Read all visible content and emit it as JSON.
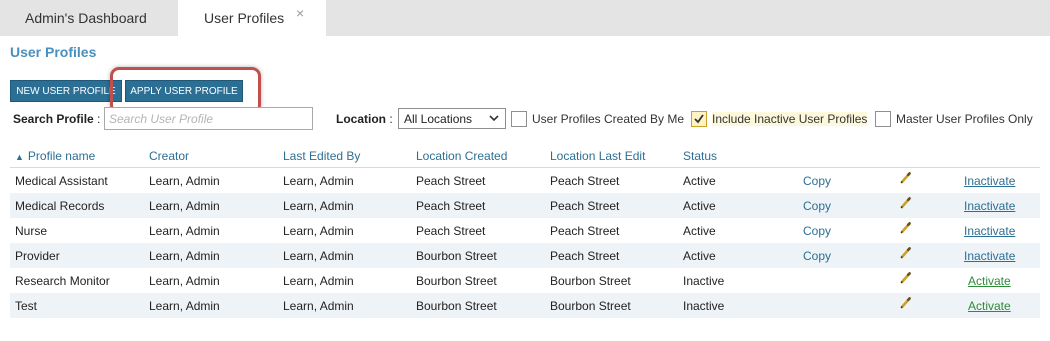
{
  "tabs": [
    {
      "label": "Admin's Dashboard"
    },
    {
      "label": "User Profiles",
      "close": "×"
    }
  ],
  "page_title": "User Profiles",
  "toolbar": {
    "new_label": "NEW USER PROFILE",
    "apply_label": "APPLY USER PROFILE"
  },
  "filters": {
    "search_label": "Search Profile",
    "search_placeholder": "Search User Profile",
    "search_value": "",
    "location_label": "Location",
    "location_value": "All Locations",
    "colon": ":",
    "cb_created_by_me": {
      "label": "User Profiles Created By Me",
      "checked": false
    },
    "cb_include_inactive": {
      "label": "Include Inactive User Profiles",
      "checked": true
    },
    "cb_master_only": {
      "label": "Master User Profiles Only",
      "checked": false
    }
  },
  "table": {
    "sort_arrow": "▲",
    "headers": [
      "Profile name",
      "Creator",
      "Last Edited By",
      "Location Created",
      "Location Last Edit",
      "Status"
    ],
    "rows": [
      {
        "name": "Medical Assistant",
        "creator": "Learn, Admin",
        "last_edited_by": "Learn, Admin",
        "location_created": "Peach Street",
        "location_last_edit": "Peach Street",
        "status": "Active",
        "copy": "Copy",
        "action": "Inactivate"
      },
      {
        "name": "Medical Records",
        "creator": "Learn, Admin",
        "last_edited_by": "Learn, Admin",
        "location_created": "Peach Street",
        "location_last_edit": "Peach Street",
        "status": "Active",
        "copy": "Copy",
        "action": "Inactivate"
      },
      {
        "name": "Nurse",
        "creator": "Learn, Admin",
        "last_edited_by": "Learn, Admin",
        "location_created": "Peach Street",
        "location_last_edit": "Peach Street",
        "status": "Active",
        "copy": "Copy",
        "action": "Inactivate"
      },
      {
        "name": "Provider",
        "creator": "Learn, Admin",
        "last_edited_by": "Learn, Admin",
        "location_created": "Bourbon Street",
        "location_last_edit": "Peach Street",
        "status": "Active",
        "copy": "Copy",
        "action": "Inactivate"
      },
      {
        "name": "Research Monitor",
        "creator": "Learn, Admin",
        "last_edited_by": "Learn, Admin",
        "location_created": "Bourbon Street",
        "location_last_edit": "Bourbon Street",
        "status": "Inactive",
        "copy": "",
        "action": "Activate"
      },
      {
        "name": "Test",
        "creator": "Learn, Admin",
        "last_edited_by": "Learn, Admin",
        "location_created": "Bourbon Street",
        "location_last_edit": "Bourbon Street",
        "status": "Inactive",
        "copy": "",
        "action": "Activate"
      }
    ]
  },
  "colors": {
    "accent": "#2c6f94",
    "title": "#4a8fbf",
    "highlight": "#c0504d",
    "activate": "#2e8b3a",
    "row_alt": "#eef3f8"
  },
  "icons": {
    "edit": "pencil-icon",
    "close": "close-icon",
    "sort": "sort-ascending-icon",
    "dropdown": "chevron-down-icon",
    "check": "checkmark-icon"
  }
}
